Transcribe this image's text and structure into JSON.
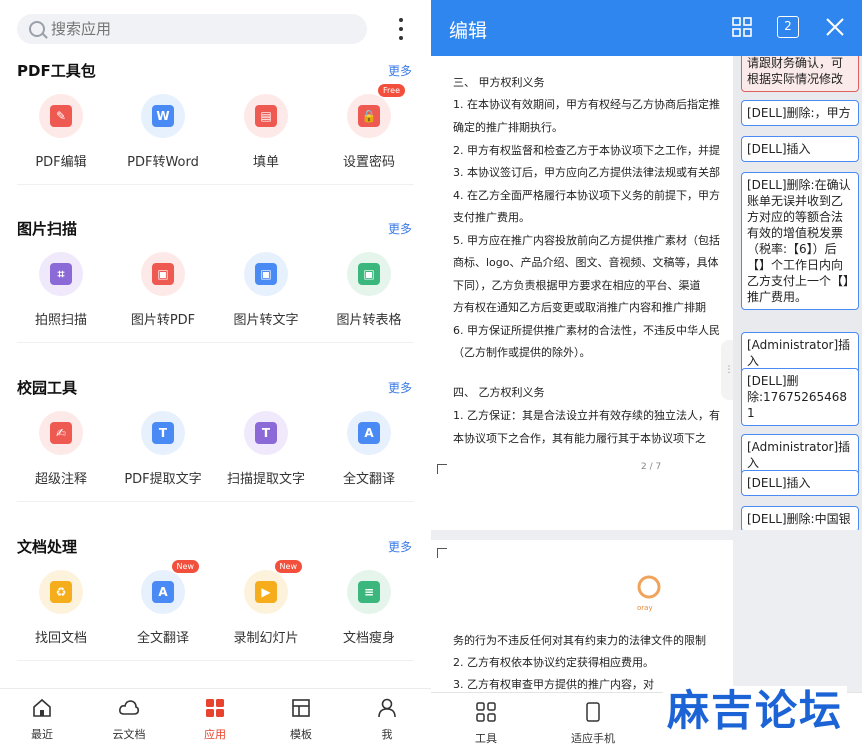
{
  "left": {
    "search_placeholder": "搜索应用",
    "sections": [
      {
        "title": "PDF工具包",
        "more": "更多",
        "tools": [
          {
            "label": "PDF编辑",
            "badge": ""
          },
          {
            "label": "PDF转Word",
            "badge": ""
          },
          {
            "label": "填单",
            "badge": ""
          },
          {
            "label": "设置密码",
            "badge": "Free"
          }
        ]
      },
      {
        "title": "图片扫描",
        "more": "更多",
        "tools": [
          {
            "label": "拍照扫描"
          },
          {
            "label": "图片转PDF"
          },
          {
            "label": "图片转文字"
          },
          {
            "label": "图片转表格"
          }
        ]
      },
      {
        "title": "校园工具",
        "more": "更多",
        "tools": [
          {
            "label": "超级注释"
          },
          {
            "label": "PDF提取文字"
          },
          {
            "label": "扫描提取文字"
          },
          {
            "label": "全文翻译"
          }
        ]
      },
      {
        "title": "文档处理",
        "more": "更多",
        "tools": [
          {
            "label": "找回文档",
            "badge": ""
          },
          {
            "label": "全文翻译",
            "badge": "New"
          },
          {
            "label": "录制幻灯片",
            "badge": "New"
          },
          {
            "label": "文档瘦身",
            "badge": ""
          }
        ]
      }
    ],
    "nav": [
      {
        "label": "最近"
      },
      {
        "label": "云文档"
      },
      {
        "label": "应用"
      },
      {
        "label": "模板"
      },
      {
        "label": "我"
      }
    ],
    "active_nav": "应用"
  },
  "right": {
    "title": "编辑",
    "header_page_icon_text": "2",
    "doc_lines": [
      "三、      甲方权利义务",
      "1.   在本协议有效期间，甲方有权经与乙方协商后指定推",
      "      确定的推广排期执行。",
      "2.   甲方有权监督和检查乙方于本协议项下之工作，并提",
      "3.   本协议签订后，甲方应向乙方提供法律法规或有关部",
      "4.   在乙方全面严格履行本协议项下义务的前提下，甲方",
      "      支付推广费用。",
      "5.   甲方应在推广内容投放前向乙方提供推广素材（包括",
      "      商标、logo、产品介绍、图文、音视频、文稿等，具体",
      "      下同），乙方负责根据甲方要求在相应的平台、渠道",
      "      方有权在通知乙方后变更或取消推广内容和推广排期",
      "6.   甲方保证所提供推广素材的合法性，不违反中华人民",
      "      （乙方制作或提供的除外）。",
      "四、      乙方权利义务",
      "1.   乙方保证：其是合法设立并有效存续的独立法人，有",
      "      本协议项下之合作，其有能力履行其于本协议项下之"
    ],
    "page_number": "2 / 7",
    "page2_logo": "oray",
    "page2_lines": [
      "      务的行为不违反任何对其有约束力的法律文件的限制",
      "2.   乙方有权依本协议约定获得相应费用。",
      "3.   乙方有权审查甲方提供的推广内容，对"
    ],
    "comments": [
      "请跟财务确认，可根据实际情况修改",
      "[DELL]删除:，甲方",
      "[DELL]插入",
      "[DELL]删除:在确认账单无误并收到乙方对应的等额合法有效的增值税发票（税率:【6】）后【】个工作日内向乙方支付上一个【】推广费用。",
      "[Administrator]插入",
      "[DELL]删除:17675265468 1",
      "[Administrator]插入",
      "[DELL]插入",
      "[DELL]删除:中国银"
    ],
    "toolbar": [
      {
        "label": "工具"
      },
      {
        "label": "适应手机"
      }
    ],
    "watermark": "麻吉论坛"
  }
}
